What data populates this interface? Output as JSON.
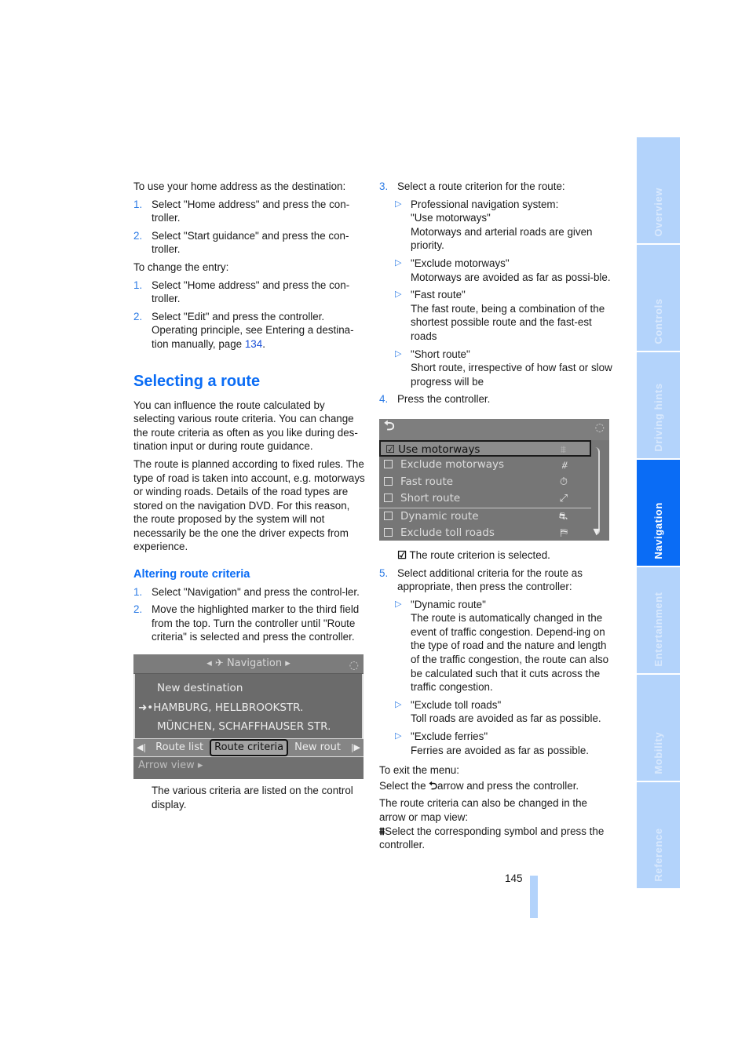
{
  "left_column": {
    "intro_home": "To use your home address as the destination:",
    "home_steps": [
      {
        "num": "1.",
        "text": "Select \"Home address\" and press the con-troller."
      },
      {
        "num": "2.",
        "text": "Select \"Start guidance\" and press the con-troller."
      }
    ],
    "intro_change": "To change the entry:",
    "change_steps": [
      {
        "num": "1.",
        "text": "Select \"Home address\" and press the con-troller."
      },
      {
        "num": "2.",
        "text": "Select \"Edit\" and press the controller. Operating principle, see Entering a destina-tion manually, page ",
        "link": "134",
        "after": "."
      }
    ],
    "heading": "Selecting a route",
    "para1": "You can influence the route calculated by selecting various route criteria. You can change the route criteria as often as you like during des-tination input or during route guidance.",
    "para2": "The route is planned according to fixed rules. The type of road is taken into account, e.g. motorways or winding roads. Details of the road types are stored on the navigation DVD. For this reason, the route proposed by the system will not necessarily be the one the driver expects from experience.",
    "subheading": "Altering route criteria",
    "alter_steps": [
      {
        "num": "1.",
        "text": "Select \"Navigation\" and press the control-ler."
      },
      {
        "num": "2.",
        "text": "Move the highlighted marker to the third field from the top. Turn the controller until \"Route criteria\" is selected and press the controller."
      }
    ],
    "nav_screen": {
      "title": "Navigation",
      "title_left_arrow": "◂",
      "title_right_arrow": "▸",
      "title_icon": "navigation-satellite-icon",
      "entries": [
        "New destination",
        "HAMBURG, HELLBROOKSTR.",
        "MÜNCHEN, SCHAFFHAUSER STR."
      ],
      "active_entry_marker": "➜•",
      "tabs": [
        "Route list",
        "Route criteria",
        "New rout"
      ],
      "selected_tab": "Route criteria",
      "bottom_item": "Arrow view ▸"
    },
    "screen_caption": "The various criteria are listed on the control display."
  },
  "right_column": {
    "step3": {
      "num": "3.",
      "text": "Select a route criterion for the route:"
    },
    "criteria_bullets": [
      {
        "lines": [
          "Professional navigation system:",
          "\"Use motorways\"",
          "Motorways and arterial roads are given priority."
        ]
      },
      {
        "lines": [
          "\"Exclude motorways\"",
          "Motorways are avoided as far as possi-ble."
        ]
      },
      {
        "lines": [
          "\"Fast route\"",
          "The fast route, being a combination of the shortest possible route and the fast-est roads"
        ]
      },
      {
        "lines": [
          "\"Short route\"",
          "Short route, irrespective of how fast or slow progress will be"
        ]
      }
    ],
    "step4": {
      "num": "4.",
      "text": "Press the controller."
    },
    "criteria_screen": {
      "back_icon": "back-arrow-icon",
      "rows": [
        {
          "label": "Use motorways",
          "checked": true,
          "icon": "motorway-icon",
          "glyph": "⩩"
        },
        {
          "label": "Exclude motorways",
          "checked": false,
          "icon": "no-motorway-icon",
          "glyph": "⧣"
        },
        {
          "label": "Fast route",
          "checked": false,
          "icon": "stopwatch-icon",
          "glyph": "⏱"
        },
        {
          "label": "Short route",
          "checked": false,
          "icon": "short-path-icon",
          "glyph": "⤢"
        },
        {
          "label": "Dynamic route",
          "checked": false,
          "icon": "traffic-jam-icon",
          "glyph": "⛐"
        },
        {
          "label": "Exclude toll roads",
          "checked": false,
          "icon": "toll-icon",
          "glyph": "⛿"
        }
      ]
    },
    "selected_note": "The route criterion is selected.",
    "step5": {
      "num": "5.",
      "text": "Select additional criteria for the route as appropriate, then press the controller:"
    },
    "additional_bullets": [
      {
        "lines": [
          "\"Dynamic route\"",
          "The route is automatically changed in the event of traffic congestion. Depend-ing on the type of road and the nature and length of the traffic congestion, the route can also be calculated such that it cuts across the traffic congestion."
        ]
      },
      {
        "lines": [
          "\"Exclude toll roads\"",
          "Toll roads are avoided as far as possible."
        ]
      },
      {
        "lines": [
          "\"Exclude ferries\"",
          "Ferries are avoided as far as possible."
        ]
      }
    ],
    "exit_intro": "To exit the menu:",
    "exit_text_before": "Select the ",
    "exit_text_after": "arrow and press the controller.",
    "alt_intro": "The route criteria can also be changed in the arrow or map view:",
    "alt_text": "Select the corresponding symbol and press the controller."
  },
  "sidebar": {
    "tabs": [
      {
        "label": "Overview",
        "active": false
      },
      {
        "label": "Controls",
        "active": false
      },
      {
        "label": "Driving hints",
        "active": false
      },
      {
        "label": "Navigation",
        "active": true
      },
      {
        "label": "Entertainment",
        "active": false
      },
      {
        "label": "Mobility",
        "active": false
      },
      {
        "label": "Reference",
        "active": false
      }
    ]
  },
  "page_number": "145",
  "colors": {
    "accent_blue": "#0a6cf5",
    "sidebar_inactive": "#b3d3fb",
    "screen_gray": "#6f6f6f"
  }
}
